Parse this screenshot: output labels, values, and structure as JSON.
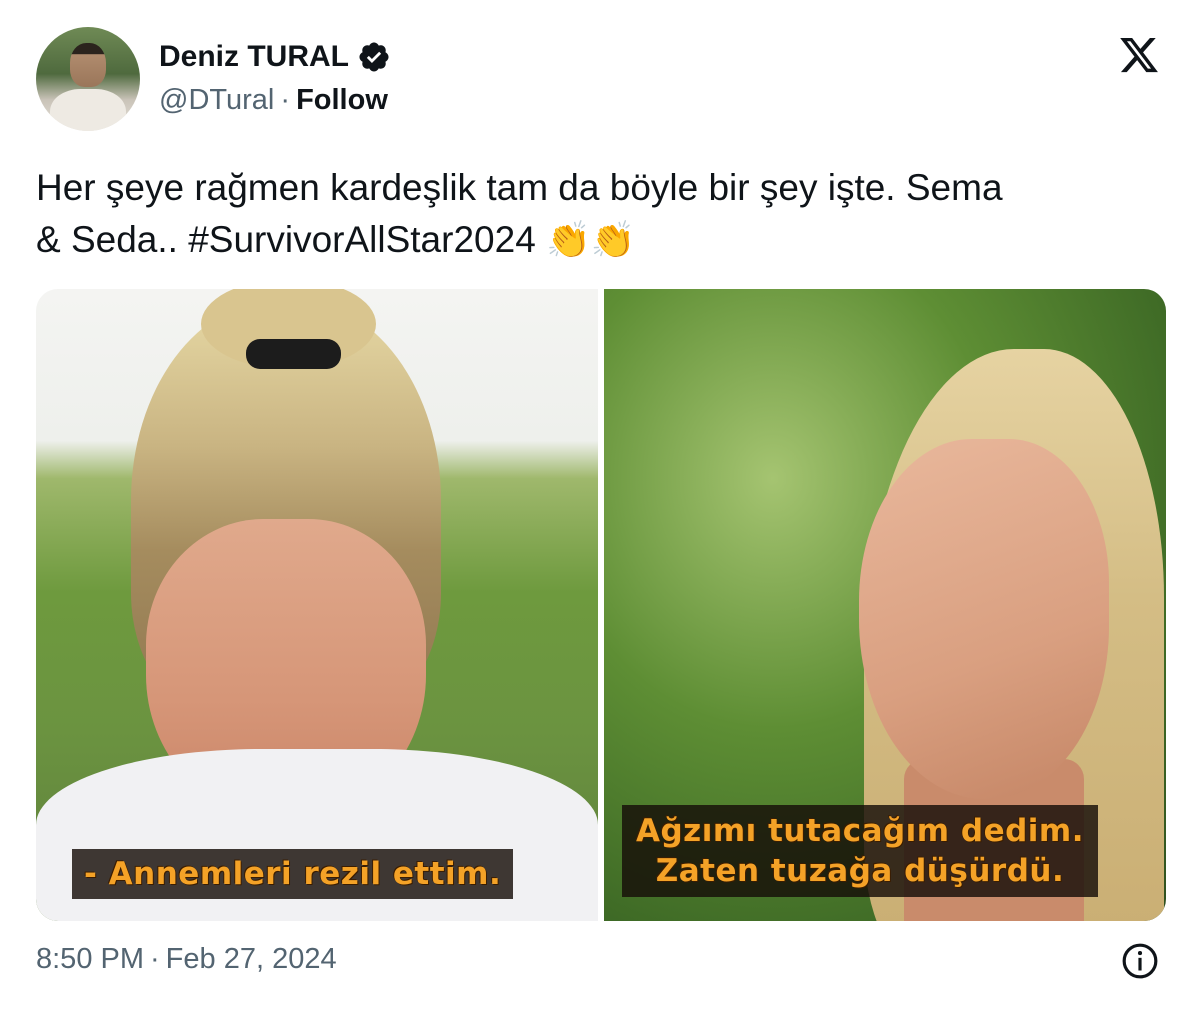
{
  "author": {
    "name": "Deniz TURAL",
    "handle": "@DTural",
    "separator": "·",
    "follow_label": "Follow",
    "verified": true
  },
  "icons": {
    "verified": "verified-badge-icon",
    "platform": "x-logo-icon",
    "info": "info-icon"
  },
  "tweet": {
    "text_line1": "Her şeye rağmen kardeşlik tam da böyle bir şey işte. Sema",
    "text_line2": "& Seda.. #SurvivorAllStar2024",
    "emojis": "👏👏"
  },
  "media": {
    "left_caption": "- Annemleri rezil ettim.",
    "right_caption_line1": "Ağzımı tutacağım dedim.",
    "right_caption_line2": "Zaten tuzağa düşürdü."
  },
  "footer": {
    "time": "8:50 PM",
    "separator": "·",
    "date": "Feb 27, 2024"
  },
  "colors": {
    "text": "#0f1419",
    "secondary": "#536471",
    "caption": "#f4a227"
  }
}
